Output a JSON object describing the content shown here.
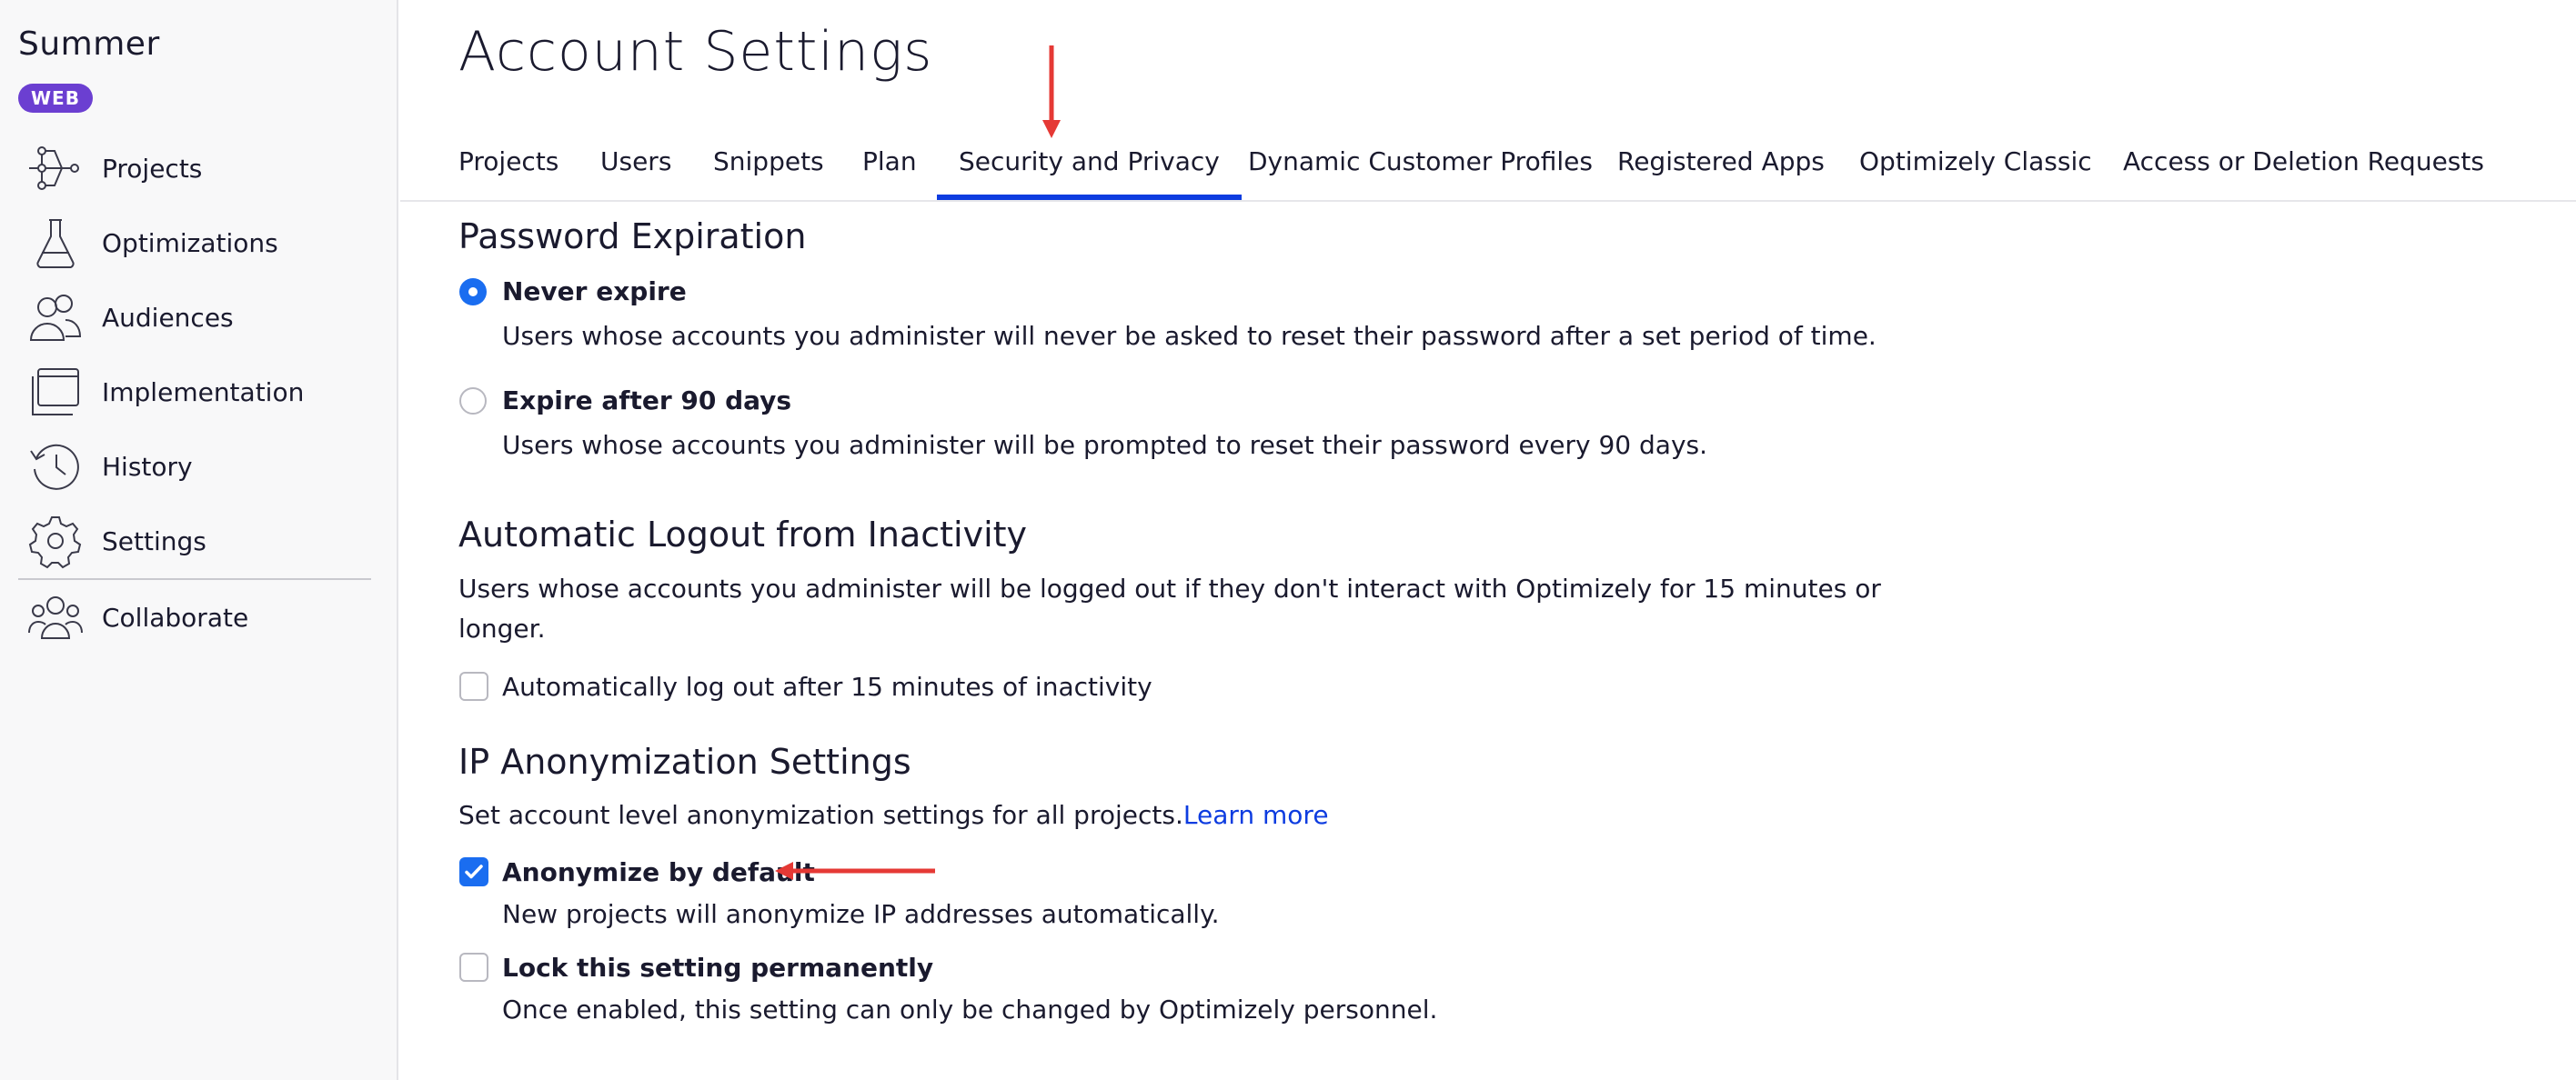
{
  "sidebar": {
    "brand": "Summer",
    "badge": "WEB",
    "items": [
      {
        "label": "Projects",
        "icon": "projects-icon"
      },
      {
        "label": "Optimizations",
        "icon": "flask-icon"
      },
      {
        "label": "Audiences",
        "icon": "audiences-icon"
      },
      {
        "label": "Implementation",
        "icon": "implementation-icon"
      },
      {
        "label": "History",
        "icon": "history-icon"
      },
      {
        "label": "Settings",
        "icon": "gear-icon"
      },
      {
        "label": "Collaborate",
        "icon": "collaborate-icon"
      }
    ]
  },
  "header": {
    "title": "Account Settings"
  },
  "tabs": [
    {
      "label": "Projects"
    },
    {
      "label": "Users"
    },
    {
      "label": "Snippets"
    },
    {
      "label": "Plan"
    },
    {
      "label": "Security and Privacy",
      "active": true
    },
    {
      "label": "Dynamic Customer Profiles"
    },
    {
      "label": "Registered Apps"
    },
    {
      "label": "Optimizely Classic"
    },
    {
      "label": "Access or Deletion Requests"
    }
  ],
  "password_expiration": {
    "heading": "Password Expiration",
    "never": {
      "label": "Never expire",
      "description": "Users whose accounts you administer will never be asked to reset their password after a set period of time.",
      "checked": true
    },
    "expire90": {
      "label": "Expire after 90 days",
      "description": "Users whose accounts you administer will be prompted to reset their password every 90 days.",
      "checked": false
    }
  },
  "auto_logout": {
    "heading": "Automatic Logout from Inactivity",
    "description_line1": "Users whose accounts you administer will be logged out if they don't interact with Optimizely for 15 minutes or",
    "description_line2": "longer.",
    "checkbox_label": "Automatically log out after 15 minutes of inactivity",
    "checked": false
  },
  "ip_anonymization": {
    "heading": "IP Anonymization Settings",
    "description": "Set account level anonymization settings for all projects.",
    "learn_more": "Learn more",
    "anonymize": {
      "label": "Anonymize by default",
      "description": "New projects will anonymize IP addresses automatically.",
      "checked": true
    },
    "lock": {
      "label": "Lock this setting permanently",
      "description": "Once enabled, this setting can only be changed by Optimizely personnel.",
      "checked": false
    }
  },
  "colors": {
    "accent": "#0d3ce0",
    "checkbox": "#1a6df0",
    "badge": "#6b3fd1",
    "annotation": "#e53935"
  }
}
